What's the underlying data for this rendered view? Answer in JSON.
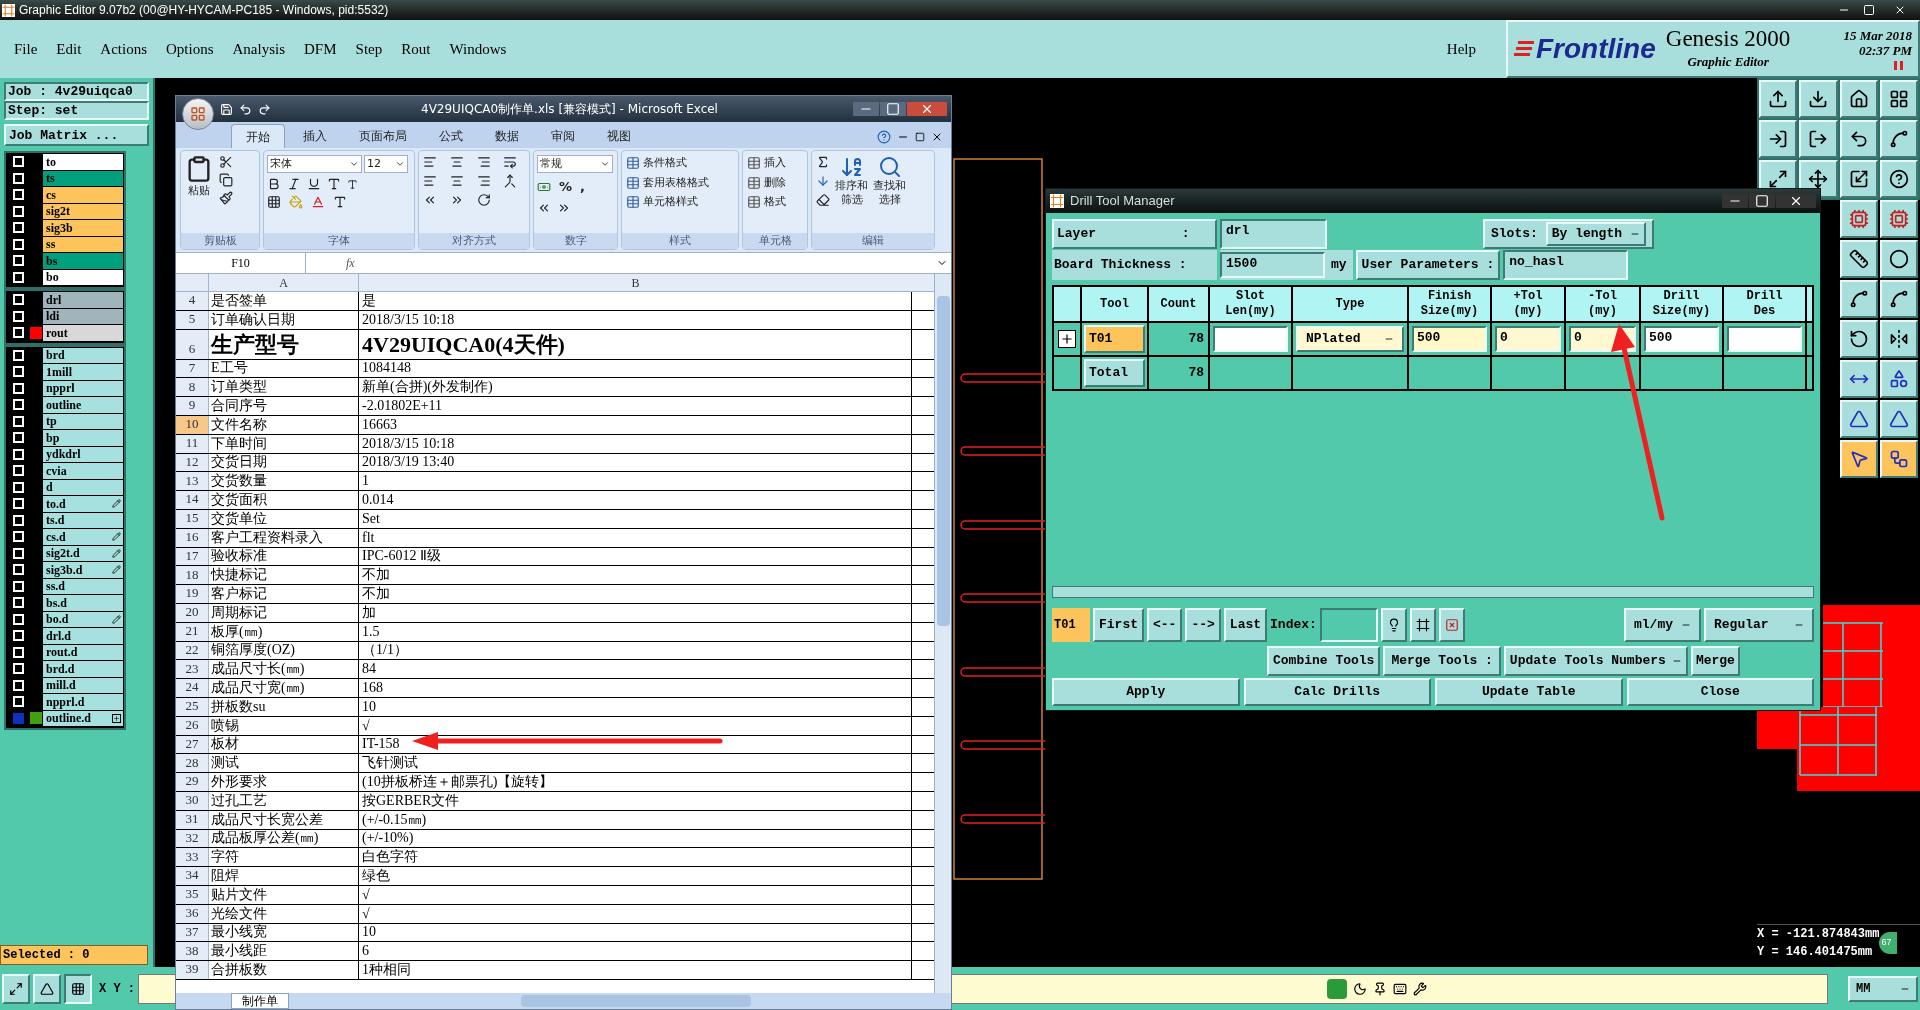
{
  "window": {
    "title": "Graphic Editor 9.07b2 (00@HY-HYCAM-PC185 - Windows, pid:5532)"
  },
  "menu": [
    "File",
    "Edit",
    "Actions",
    "Options",
    "Analysis",
    "DFM",
    "Step",
    "Rout",
    "Windows"
  ],
  "help": "Help",
  "brand": {
    "logo": "Frontline",
    "product": "Genesis 2000",
    "subtitle": "Graphic Editor",
    "date": "15 Mar 2018",
    "time": "02:37 PM"
  },
  "job": {
    "job": "Job : 4v29uiqca0",
    "step": "Step: set",
    "matrix_button": "Job Matrix ..."
  },
  "layer_groups": [
    [
      {
        "name": "to",
        "color": "#ffffff",
        "selected": false
      },
      {
        "name": "ts",
        "color": "#00a07e",
        "selected": false
      },
      {
        "name": "cs",
        "color": "#fcc45a",
        "selected": false
      },
      {
        "name": "sig2t",
        "color": "#fcc45a",
        "selected": false
      },
      {
        "name": "sig3b",
        "color": "#fcc45a",
        "selected": false
      },
      {
        "name": "ss",
        "color": "#fcc45a",
        "selected": false
      },
      {
        "name": "bs",
        "color": "#00a07e",
        "selected": false
      },
      {
        "name": "bo",
        "color": "#ffffff",
        "selected": false
      }
    ],
    [
      {
        "name": "drl",
        "color": "#a0b4bc",
        "selected": false
      },
      {
        "name": "ldi",
        "color": "#a0b4bc",
        "selected": false
      },
      {
        "name": "rout",
        "color": "#d8d8d8",
        "marker": {
          "color": "#ff0000"
        },
        "selected": false
      }
    ],
    [
      {
        "name": "brd",
        "color": "#a6e0df",
        "selected": false
      },
      {
        "name": "1mill",
        "color": "#a6e0df",
        "selected": false
      },
      {
        "name": "npprl",
        "color": "#a6e0df",
        "selected": false
      },
      {
        "name": "outline",
        "color": "#a6e0df",
        "selected": false
      },
      {
        "name": "tp",
        "color": "#a6e0df",
        "selected": false
      },
      {
        "name": "bp",
        "color": "#a6e0df",
        "selected": false
      },
      {
        "name": "ydkdrl",
        "color": "#a6e0df",
        "selected": false
      },
      {
        "name": "cvia",
        "color": "#a6e0df",
        "selected": false
      },
      {
        "name": "d",
        "color": "#a6e0df",
        "selected": false
      },
      {
        "name": "to.d",
        "color": "#a6e0df",
        "kind": "edit",
        "selected": false
      },
      {
        "name": "ts.d",
        "color": "#a6e0df",
        "selected": false
      },
      {
        "name": "cs.d",
        "color": "#a6e0df",
        "kind": "edit",
        "selected": false
      },
      {
        "name": "sig2t.d",
        "color": "#a6e0df",
        "kind": "edit",
        "selected": false
      },
      {
        "name": "sig3b.d",
        "color": "#a6e0df",
        "kind": "edit",
        "selected": false
      },
      {
        "name": "ss.d",
        "color": "#a6e0df",
        "selected": false
      },
      {
        "name": "bs.d",
        "color": "#a6e0df",
        "selected": false
      },
      {
        "name": "bo.d",
        "color": "#a6e0df",
        "kind": "edit",
        "selected": false
      },
      {
        "name": "drl.d",
        "color": "#a6e0df",
        "selected": false
      },
      {
        "name": "rout.d",
        "color": "#a6e0df",
        "selected": false
      },
      {
        "name": "brd.d",
        "color": "#a6e0df",
        "selected": false
      },
      {
        "name": "mill.d",
        "color": "#a6e0df",
        "selected": false
      },
      {
        "name": "npprl.d",
        "color": "#a6e0df",
        "selected": false
      },
      {
        "name": "outline.d",
        "color": "#a6e0df",
        "marker": {
          "color": "#40a010"
        },
        "kind": "grid",
        "selected": true
      }
    ]
  ],
  "selected_count": "Selected : 0",
  "xy_label": "X Y :",
  "excel": {
    "title": "4V29UIQCA0制作单.xls  [兼容模式] - Microsoft Excel",
    "tabs": [
      {
        "label": "开始",
        "selected": true
      },
      {
        "label": "插入",
        "selected": false
      },
      {
        "label": "页面布局",
        "selected": false
      },
      {
        "label": "公式",
        "selected": false
      },
      {
        "label": "数据",
        "selected": false
      },
      {
        "label": "审阅",
        "selected": false
      },
      {
        "label": "视图",
        "selected": false
      }
    ],
    "paste": "粘贴",
    "font": "宋体",
    "font_size": "12",
    "number_format": "常规",
    "number_symbols": [
      "%",
      ","
    ],
    "style_buttons": [
      "条件格式",
      "套用表格格式",
      "单元格样式"
    ],
    "cell_buttons": [
      "插入",
      "删除",
      "格式"
    ],
    "sort": [
      "排序和",
      "筛选"
    ],
    "find": [
      "查找和",
      "选择"
    ],
    "groups": [
      "剪贴板",
      "字体",
      "对齐方式",
      "数字",
      "样式",
      "单元格",
      "编辑"
    ],
    "name_box": "F10",
    "fx": "fx",
    "columns": [
      "A",
      "B"
    ],
    "rows": [
      {
        "num": "4",
        "a": "是否签单",
        "b": "是",
        "selected": false
      },
      {
        "num": "5",
        "a": "订单确认日期",
        "b": "2018/3/15 10:18",
        "selected": false
      },
      {
        "num": "6",
        "a": "生产型号",
        "b": "4V29UIQCA0(4天件)",
        "large": true,
        "selected": false
      },
      {
        "num": "7",
        "a": "E工号",
        "b": "1084148",
        "selected": false
      },
      {
        "num": "8",
        "a": "订单类型",
        "b": "新单(合拼)(外发制作)",
        "selected": false
      },
      {
        "num": "9",
        "a": "合同序号",
        "b": "-2.01802E+11",
        "selected": false
      },
      {
        "num": "10",
        "a": "文件名称",
        "b": "16663",
        "selected": true
      },
      {
        "num": "11",
        "a": "下单时间",
        "b": "2018/3/15 10:18",
        "selected": false
      },
      {
        "num": "12",
        "a": "交货日期",
        "b": "2018/3/19 13:40",
        "selected": false
      },
      {
        "num": "13",
        "a": "交货数量",
        "b": "1",
        "selected": false
      },
      {
        "num": "14",
        "a": "交货面积",
        "b": "0.014",
        "selected": false
      },
      {
        "num": "15",
        "a": "交货单位",
        "b": "Set",
        "selected": false
      },
      {
        "num": "16",
        "a": "客户工程资料录入",
        "b": "flt",
        "selected": false
      },
      {
        "num": "17",
        "a": "验收标准",
        "b": "IPC-6012 Ⅱ级",
        "selected": false
      },
      {
        "num": "18",
        "a": "快捷标记",
        "b": "不加",
        "selected": false
      },
      {
        "num": "19",
        "a": "客户标记",
        "b": "不加",
        "selected": false
      },
      {
        "num": "20",
        "a": "周期标记",
        "b": "加",
        "selected": false
      },
      {
        "num": "21",
        "a": "板厚(㎜)",
        "b": "1.5",
        "selected": false
      },
      {
        "num": "22",
        "a": "铜箔厚度(OZ)",
        "b": "（1/1）",
        "selected": false
      },
      {
        "num": "23",
        "a": "成品尺寸长(㎜)",
        "b": "84",
        "selected": false
      },
      {
        "num": "24",
        "a": "成品尺寸宽(㎜)",
        "b": "168",
        "selected": false
      },
      {
        "num": "25",
        "a": "拼板数su",
        "b": "10",
        "selected": false
      },
      {
        "num": "26",
        "a": "喷锡",
        "b": "√",
        "selected": false
      },
      {
        "num": "27",
        "a": "板材",
        "b": "IT-158",
        "selected": false
      },
      {
        "num": "28",
        "a": "测试",
        "b": "飞针测试",
        "selected": false
      },
      {
        "num": "29",
        "a": "外形要求",
        "b": "(10拼板桥连＋邮票孔)【旋转】",
        "selected": false
      },
      {
        "num": "30",
        "a": "过孔工艺",
        "b": "按GERBER文件",
        "selected": false
      },
      {
        "num": "31",
        "a": "成品尺寸长宽公差",
        "b": "(+/-0.15㎜)",
        "selected": false
      },
      {
        "num": "32",
        "a": "成品板厚公差(㎜)",
        "b": "(+/-10%)",
        "selected": false
      },
      {
        "num": "33",
        "a": "字符",
        "b": "白色字符",
        "selected": false
      },
      {
        "num": "34",
        "a": "阻焊",
        "b": "绿色",
        "selected": false
      },
      {
        "num": "35",
        "a": "贴片文件",
        "b": "√",
        "selected": false
      },
      {
        "num": "36",
        "a": "光绘文件",
        "b": "√",
        "selected": false
      },
      {
        "num": "37",
        "a": "最小线宽",
        "b": "10",
        "selected": false
      },
      {
        "num": "38",
        "a": "最小线距",
        "b": "6",
        "selected": false
      },
      {
        "num": "39",
        "a": "合拼板数",
        "b": "1种相同",
        "selected": false
      }
    ],
    "sheet_tab": "制作单"
  },
  "drill_manager": {
    "title": "Drill Tool Manager",
    "layer_label": "Layer           :",
    "layer": "drl",
    "slots_label": "Slots:",
    "slots": "By length",
    "thickness_label": "Board Thickness :",
    "thickness": "1500",
    "unit": "my",
    "user_params_label": "User Parameters :",
    "user_params": "no_hasl",
    "columns": [
      [
        "Tool"
      ],
      [
        "Count"
      ],
      [
        "Slot",
        "Len(my)"
      ],
      [
        "Type"
      ],
      [
        "Finish",
        "Size(my)"
      ],
      [
        "+Tol",
        "(my)"
      ],
      [
        "-Tol",
        "(my)"
      ],
      [
        "Drill",
        "Size(my)"
      ],
      [
        "Drill",
        "Des"
      ]
    ],
    "rows": [
      {
        "tool": "T01",
        "count": "78",
        "slot_len": "",
        "type": "NPlated",
        "finish": "500",
        "plus_tol": "0",
        "minus_tol": "0",
        "drill_size": "500",
        "drill_des": ""
      }
    ],
    "total": {
      "label": "Total",
      "count": "78"
    },
    "current": "T01",
    "nav": [
      "First",
      "<--",
      "-->",
      "Last"
    ],
    "index_label": "Index:",
    "units": "ml/my",
    "mode": "Regular",
    "combine": "Combine Tools",
    "merge_label": "Merge Tools :",
    "merge_mode": "Update Tools Numbers",
    "merge": "Merge",
    "actions": [
      "Apply",
      "Calc Drills",
      "Update Table",
      "Close"
    ]
  },
  "coords": {
    "x": "X = -121.874843mm",
    "y": "Y = 146.401475mm",
    "badge": "67"
  },
  "units": "MM"
}
